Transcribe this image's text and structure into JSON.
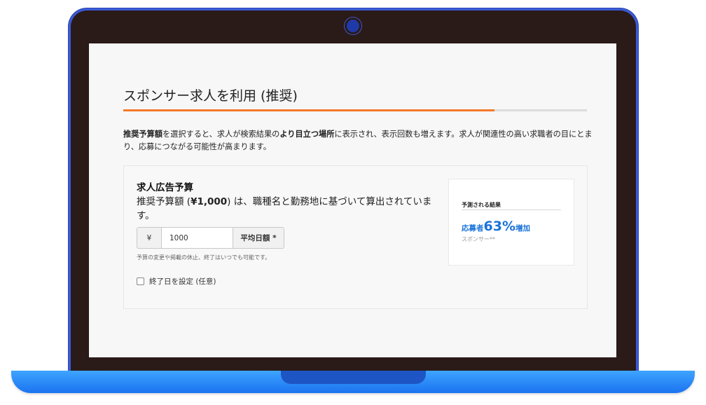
{
  "page": {
    "title": "スポンサー求人を利用 (推奨)",
    "progress_percent": 80,
    "intro": {
      "b1": "推奨予算額",
      "t1": "を選択すると、求人が検索結果の",
      "b2": "より目立つ場所",
      "t2": "に表示され、表示回数も増えます。求人が関連性の高い求職者の目にとまり、応募につながる可能性が高まります。"
    }
  },
  "budget": {
    "title": "求人広告予算",
    "desc_pre": "推奨予算額 (",
    "desc_amount": "¥1,000",
    "desc_post": ") は、職種名と勤務地に基づいて算出されています。",
    "currency": "¥",
    "value": "1000",
    "suffix": "平均日額 *",
    "hint": "予算の変更や掲載の休止、終了はいつでも可能です。",
    "end_date_label": "終了日を設定 (任意)"
  },
  "result": {
    "title": "予測される結果",
    "prefix": "応募者",
    "percent": "63%",
    "suffix": "増加",
    "sub": "スポンサー**"
  },
  "colors": {
    "accent_orange": "#f57a2a",
    "result_blue": "#1a73d9",
    "laptop_blue": "#1b73f0"
  }
}
